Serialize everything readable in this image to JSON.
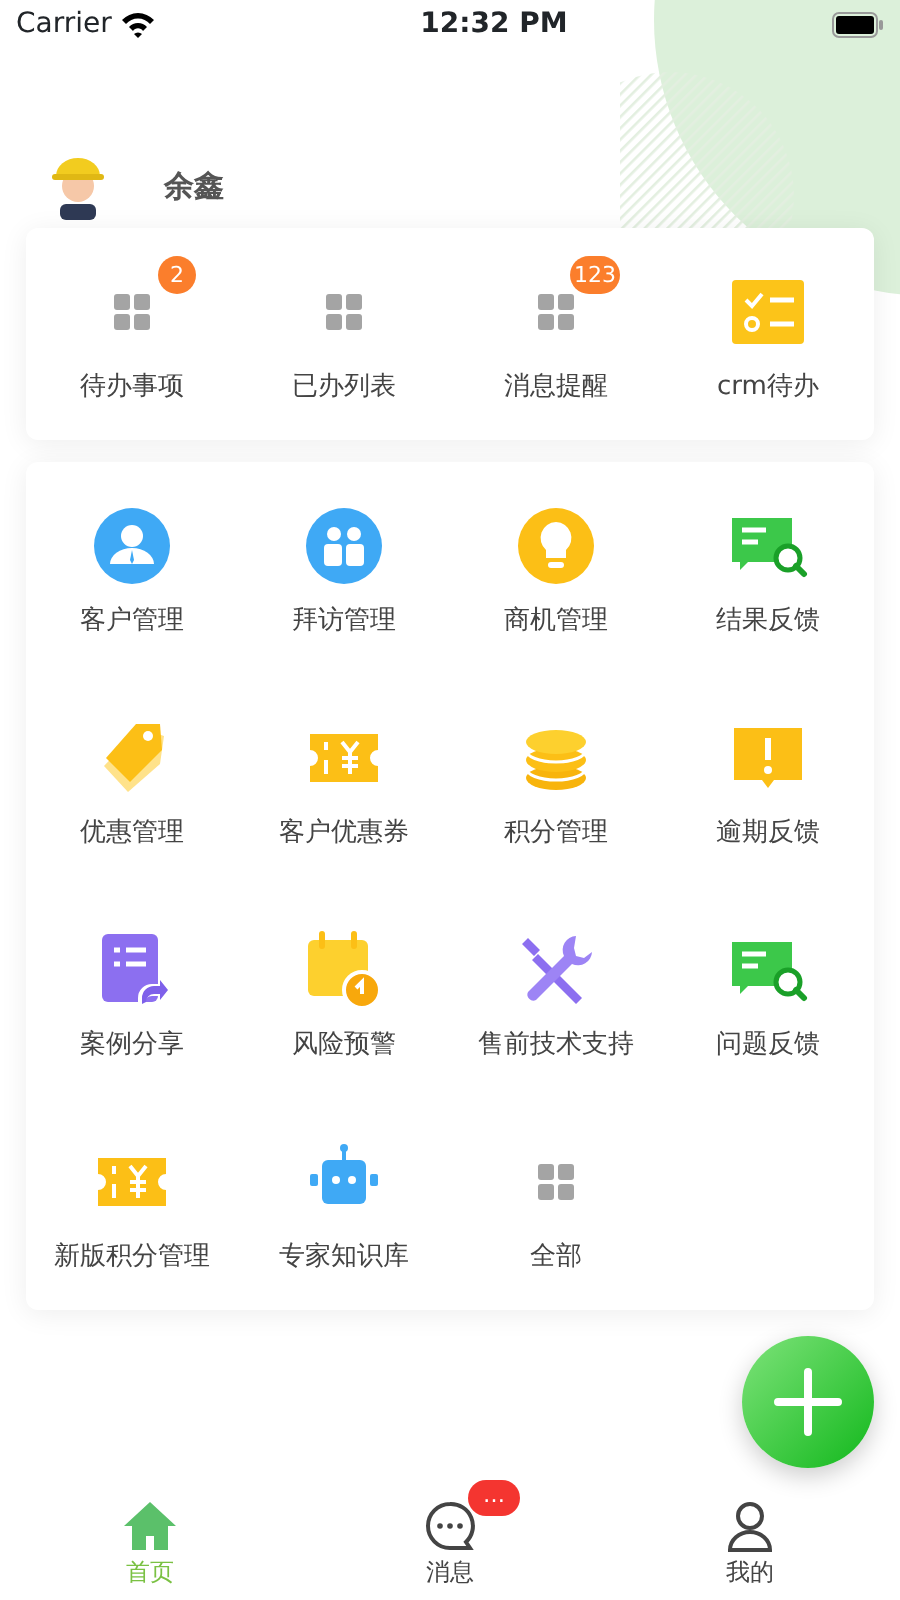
{
  "status_bar": {
    "carrier": "Carrier",
    "time": "12:32 PM"
  },
  "user": {
    "name": "余鑫"
  },
  "quick_items": [
    {
      "label": "待办事项",
      "kind": "grid",
      "badge": "2"
    },
    {
      "label": "已办列表",
      "kind": "grid"
    },
    {
      "label": "消息提醒",
      "kind": "grid",
      "badge": "123"
    },
    {
      "label": "crm待办",
      "kind": "checklist"
    }
  ],
  "apps": [
    {
      "label": "客户管理",
      "kind": "person"
    },
    {
      "label": "拜访管理",
      "kind": "people"
    },
    {
      "label": "商机管理",
      "kind": "bulb"
    },
    {
      "label": "结果反馈",
      "kind": "chat-search"
    },
    {
      "label": "优惠管理",
      "kind": "tag"
    },
    {
      "label": "客户优惠券",
      "kind": "ticket"
    },
    {
      "label": "积分管理",
      "kind": "coins"
    },
    {
      "label": "逾期反馈",
      "kind": "alert"
    },
    {
      "label": "案例分享",
      "kind": "doc-share"
    },
    {
      "label": "风险预警",
      "kind": "calendar"
    },
    {
      "label": "售前技术支持",
      "kind": "tools"
    },
    {
      "label": "问题反馈",
      "kind": "chat-search"
    },
    {
      "label": "新版积分管理",
      "kind": "ticket"
    },
    {
      "label": "专家知识库",
      "kind": "robot"
    },
    {
      "label": "全部",
      "kind": "grid"
    }
  ],
  "tab_bar": [
    {
      "label": "首页",
      "kind": "home",
      "selected": true
    },
    {
      "label": "消息",
      "kind": "chat",
      "selected": false,
      "badge": "…"
    },
    {
      "label": "我的",
      "kind": "user",
      "selected": false
    }
  ]
}
